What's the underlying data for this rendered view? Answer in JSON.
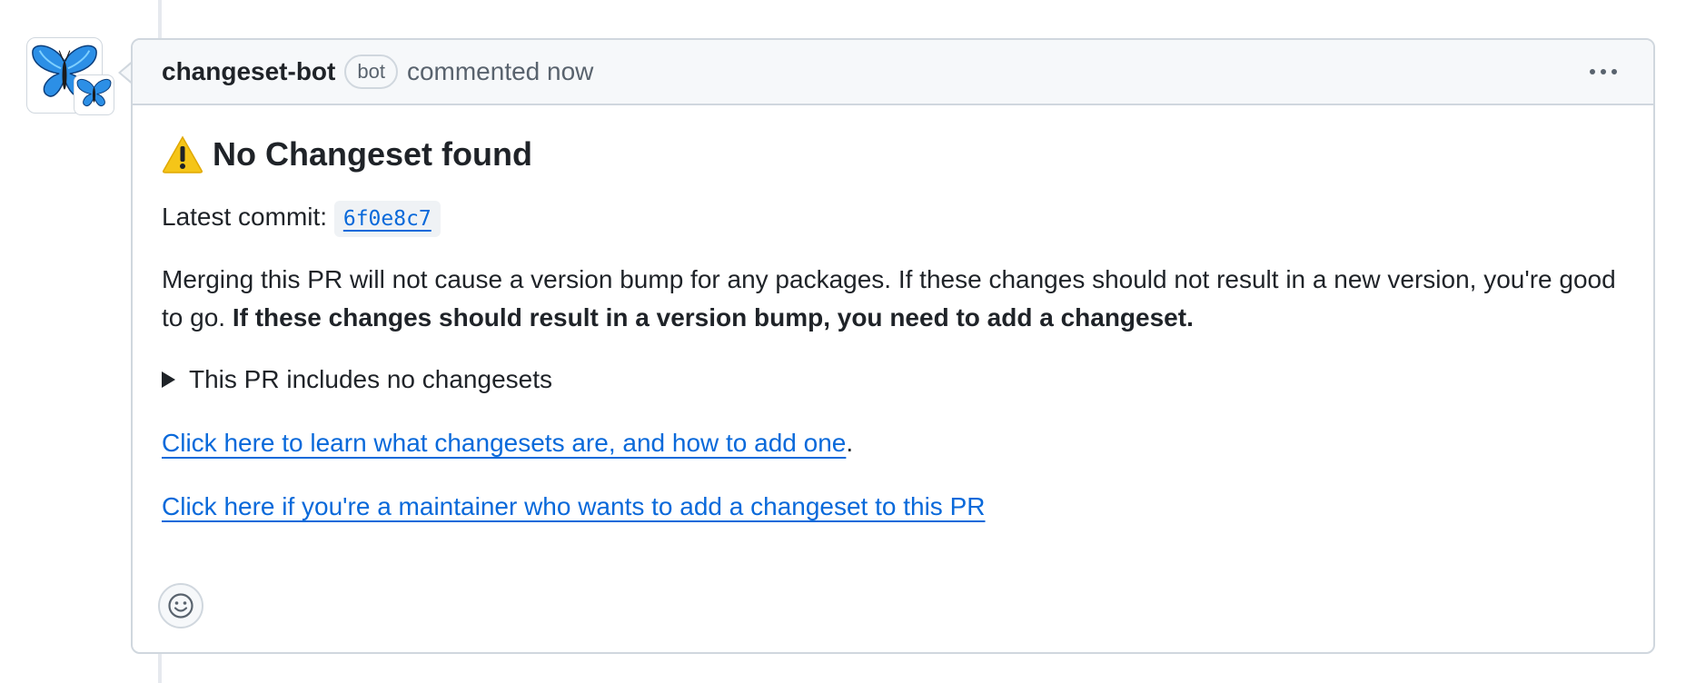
{
  "comment": {
    "author": "changeset-bot",
    "badge": "bot",
    "meta": "commented now",
    "heading_emoji": "warning-icon",
    "heading": "No Changeset found",
    "commit_label": "Latest commit:",
    "commit_sha": "6f0e8c7",
    "paragraph_regular": "Merging this PR will not cause a version bump for any packages. If these changes should not result in a new version, you're good to go.",
    "paragraph_bold": "If these changes should result in a version bump, you need to add a changeset.",
    "details_summary": "This PR includes no changesets",
    "learn_link": "Click here to learn what changesets are, and how to add one",
    "learn_suffix": ".",
    "maintainer_link": "Click here if you're a maintainer who wants to add a changeset to this PR"
  },
  "icons": {
    "avatar": "butterfly-icon",
    "menu": "kebab-icon",
    "reaction": "smiley-icon",
    "details": "triangle-right-icon"
  },
  "colors": {
    "link": "#0969da",
    "header_bg": "#f6f8fa",
    "border": "#d0d7de",
    "warning": "#f5c518"
  }
}
